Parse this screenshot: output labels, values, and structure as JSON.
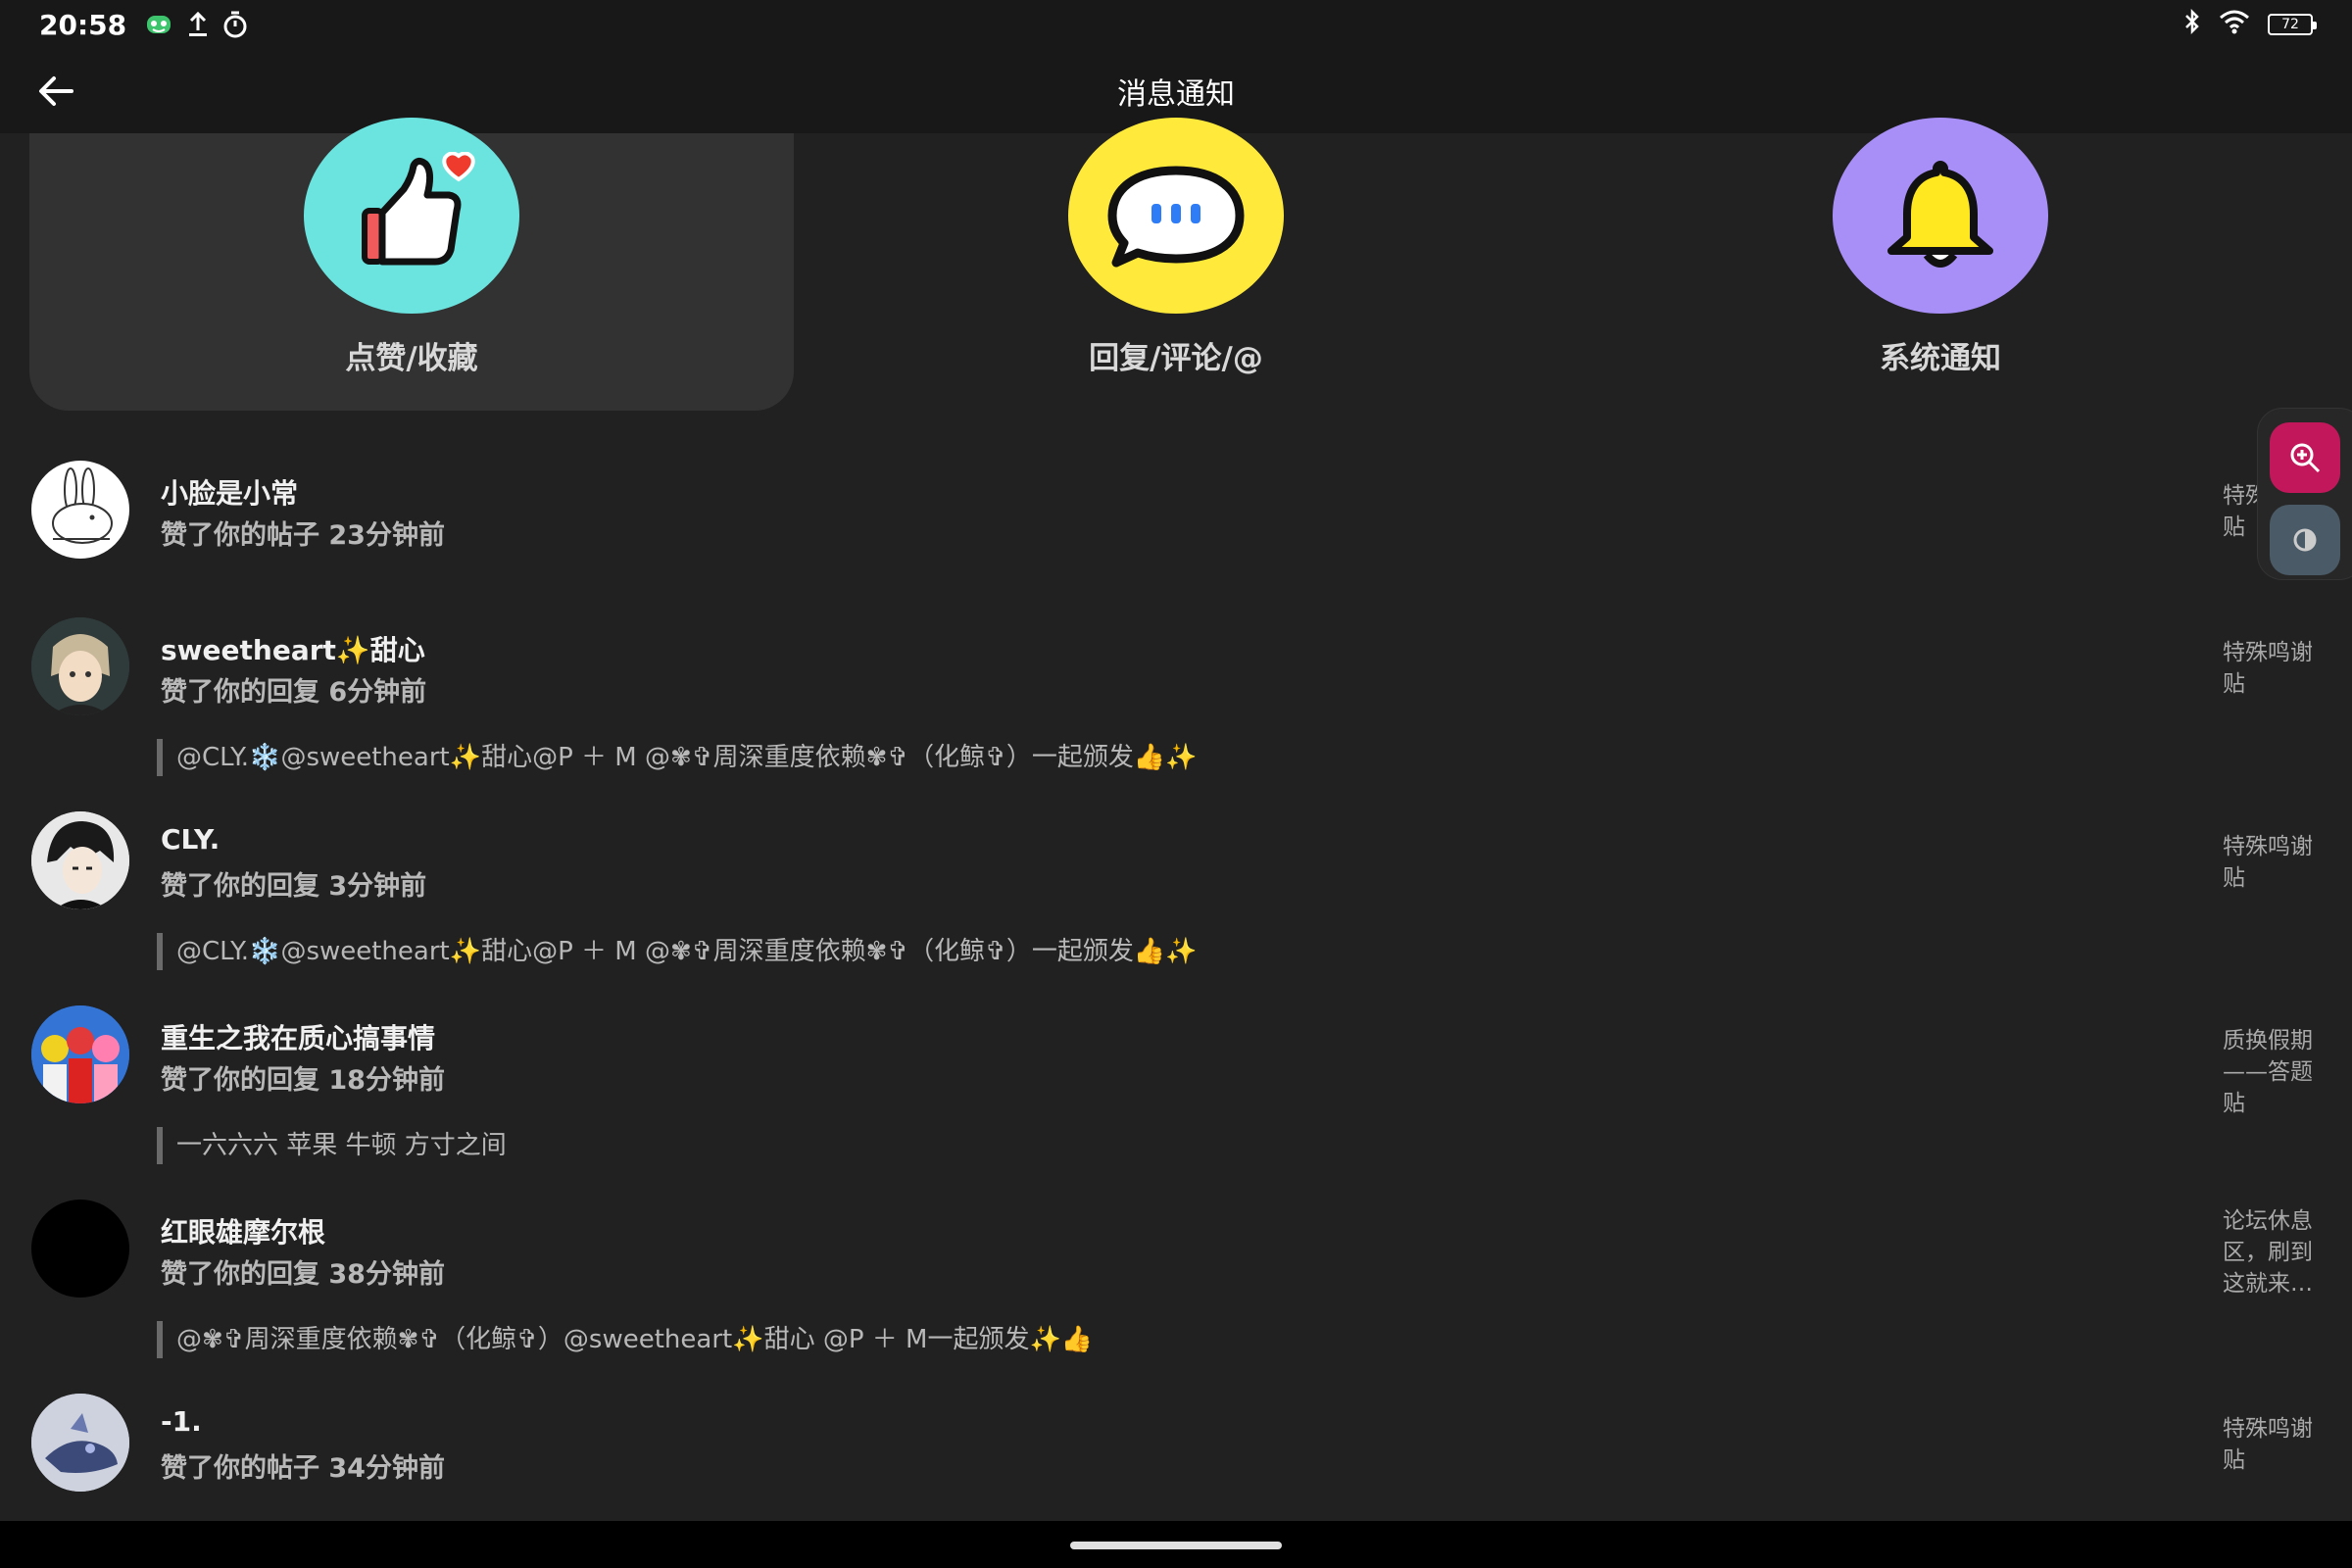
{
  "status_bar": {
    "time": "20:58",
    "battery": "72"
  },
  "header": {
    "title": "消息通知"
  },
  "categories": [
    {
      "label": "点赞/收藏",
      "color": "#6be3df",
      "icon": "thumbs-up-icon"
    },
    {
      "label": "回复/评论/@",
      "color": "#ffea3c",
      "icon": "chat-bubble-icon"
    },
    {
      "label": "系统通知",
      "color": "#a88ff7",
      "icon": "bell-icon"
    }
  ],
  "notifications": [
    {
      "name": "小脸是小常",
      "action": "赞了你的帖子 23分钟前",
      "quote": "",
      "target": "特殊鸣谢贴",
      "avatar": "rabbit"
    },
    {
      "name": "sweetheart✨甜心",
      "action": "赞了你的回复 6分钟前",
      "quote": "@CLY.❄️@sweetheart✨甜心@P ＋ M @✾✞周深重度依赖✾✞（化鲸✞）一起颁发👍✨",
      "target": "特殊鸣谢贴",
      "avatar": "anime-boy"
    },
    {
      "name": "CLY.",
      "action": "赞了你的回复 3分钟前",
      "quote": "@CLY.❄️@sweetheart✨甜心@P ＋ M @✾✞周深重度依赖✾✞（化鲸✞）一起颁发👍✨",
      "target": "特殊鸣谢贴",
      "avatar": "dark-hair"
    },
    {
      "name": "重生之我在质心搞事情",
      "action": "赞了你的回复 18分钟前",
      "quote": "一六六六 苹果 牛顿 方寸之间",
      "target": "质换假期——答题贴",
      "avatar": "heroes"
    },
    {
      "name": "红眼雄摩尔根",
      "action": "赞了你的回复 38分钟前",
      "quote": "@✾✞周深重度依赖✾✞（化鲸✞）@sweetheart✨甜心 @P ＋ M一起颁发✨👍",
      "target": "论坛休息区，刷到这就来…",
      "avatar": "black"
    },
    {
      "name": "-1.",
      "action": "赞了你的帖子 34分钟前",
      "quote": "",
      "target": "特殊鸣谢贴",
      "avatar": "figure"
    }
  ],
  "colors": {
    "background": "#212121",
    "bar": "#181818",
    "accent_pink": "#c2185b",
    "accent_slate": "#4a5a66"
  }
}
